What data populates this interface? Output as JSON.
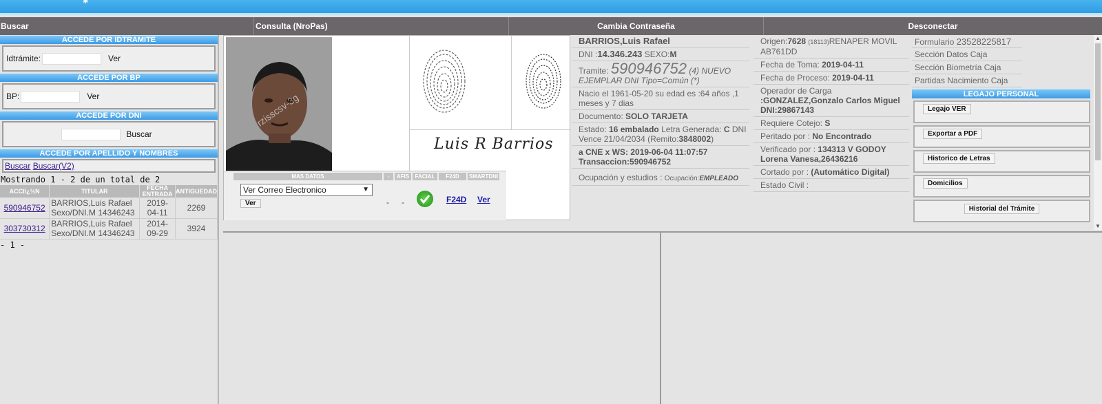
{
  "menu": {
    "buscar": "Buscar",
    "consulta": "Consulta (NroPas)",
    "cambia": "Cambia Contraseña",
    "desconectar": "Desconectar"
  },
  "left": {
    "sec_idtramite": "ACCEDE POR IDTRAMITE",
    "idtramite_label": "Idtrámite:",
    "ver": "Ver",
    "sec_bp": "ACCEDE POR BP",
    "bp_label": "BP:",
    "sec_dni": "ACCEDE POR DNI",
    "buscar": "Buscar",
    "sec_apellido": "ACCEDE POR APELLIDO Y NOMBRES",
    "link_buscar": "Buscar",
    "link_buscar_v2": "Buscar(V2)",
    "showing": "Mostrando 1 - 2 de un total de 2",
    "columns": [
      "ACCIï¿½N",
      "TITULAR",
      "FECHA ENTRADA",
      "ANTIGUEDAD"
    ],
    "rows": [
      {
        "accion": "590946752",
        "titular": "BARRIOS,Luis Rafael Sexo/DNI.M 14346243",
        "fecha": "2019-04-11",
        "antiguedad": "2269"
      },
      {
        "accion": "303730312",
        "titular": "BARRIOS,Luis Rafael Sexo/DNI.M 14346243",
        "fecha": "2014-09-29",
        "antiguedad": "3924"
      }
    ],
    "pager": "- 1 -"
  },
  "center": {
    "photo_watermark": "rzisscsv-3g",
    "signature_text": "Luis R Barrios",
    "mas_datos": "MAS DATOS",
    "col_dash": "-",
    "col_afis": "AFIS",
    "col_facial": "FACIAL",
    "col_f24d": "F24D",
    "col_smartdni": "SMARTDNI",
    "select_value": "Ver Correo Electronico",
    "ver": "Ver",
    "afis_dash1": "-",
    "afis_dash2": "-",
    "f24d_link": "F24D",
    "ver_link": "Ver"
  },
  "person": {
    "name": "BARRIOS,Luis Rafael",
    "dni_label": "DNI :",
    "dni": "14.346.243",
    "sexo_label": "SEXO:",
    "sexo": "M",
    "tramite_label": "Tramite:",
    "tramite_num": "590946752",
    "tramite_rest": "(4) NUEVO EJEMPLAR DNI Tipo=Común (*)",
    "nacio": "Nacio el 1961-05-20 su edad es :64 años ,1 meses y 7 dias",
    "documento_label": "Documento:",
    "documento": "SOLO TARJETA",
    "estado_label": "Estado:",
    "estado": "16 embalado",
    "letra_label": "Letra Generada:",
    "letra": "C",
    "vence_text": "DNI Vence 21/04/2034 (Remito:",
    "remito": "3848002",
    "remito_close": ")",
    "cne": "a CNE x WS: 2019-06-04 11:07:57",
    "transaccion": "Transaccion:590946752",
    "ocupacion_label": "Ocupación y estudios :",
    "ocupacion_small": "Ocupación:",
    "ocupacion": "EMPLEADO"
  },
  "process": {
    "origen_label": "Origen:",
    "origen": "7628",
    "origen_code": "(18113)",
    "origen_rest": "RENAPER MOVIL AB761DD",
    "toma_label": "Fecha de Toma:",
    "toma": "2019-04-11",
    "proceso_label": "Fecha de Proceso:",
    "proceso": "2019-04-11",
    "operador_label": "Operador de Carga",
    "operador": ":GONZALEZ,Gonzalo Carlos Miguel DNI:29867143",
    "cotejo_label": "Requiere Cotejo:",
    "cotejo": "S",
    "peritado_label": "Peritado por :",
    "peritado": "No Encontrado",
    "verificado_label": "Verificado por :",
    "verificado": "134313 V GODOY Lorena Vanesa,26436216",
    "cortado_label": "Cortado por :",
    "cortado": "(Automático Digital)",
    "civil_label": "Estado Civil :"
  },
  "right": {
    "formulario_label": "Formulario",
    "formulario": "23528225817",
    "sec_datos_caja": "Sección Datos Caja",
    "sec_biometria": "Sección Biometría Caja",
    "partidas": "Partidas Nacimiento Caja",
    "legajo": "LEGAJO PERSONAL",
    "legajo_ver": "Legajo VER",
    "exportar": "Exportar a PDF",
    "historico": "Historico de Letras",
    "domicilios": "Domicilios",
    "historial": "Historial del Trámite"
  },
  "colors": {
    "topbar": "#3aa6e8",
    "menubar": "#6a666a",
    "section": "#4aa3ea"
  }
}
